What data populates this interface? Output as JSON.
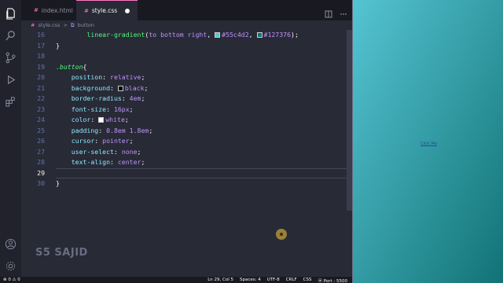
{
  "tabs": [
    {
      "icon": "#",
      "label": "index.html",
      "active": false
    },
    {
      "icon": "#",
      "label": "style.css",
      "active": true,
      "modified": true
    }
  ],
  "breadcrumb": {
    "file": "style.css",
    "separator": ">",
    "symbol": "button"
  },
  "editor": {
    "current_line": 29,
    "lines": [
      {
        "n": 16,
        "tokens": [
          {
            "t": "        "
          },
          {
            "t": "linear-gradient",
            "c": "fn"
          },
          {
            "t": "(",
            "c": "pl"
          },
          {
            "t": "to bottom right",
            "c": "val"
          },
          {
            "t": ", ",
            "c": "pl"
          },
          {
            "sw": "#55c4d2"
          },
          {
            "t": "#55c4d2",
            "c": "val"
          },
          {
            "t": ", ",
            "c": "pl"
          },
          {
            "sw": "#127376"
          },
          {
            "t": "#127376",
            "c": "val"
          },
          {
            "t": ");",
            "c": "pl"
          }
        ]
      },
      {
        "n": 17,
        "tokens": [
          {
            "t": "}",
            "c": "pl"
          }
        ]
      },
      {
        "n": 18,
        "tokens": []
      },
      {
        "n": 19,
        "tokens": [
          {
            "t": ".button",
            "c": "sel"
          },
          {
            "t": "{",
            "c": "pl"
          }
        ]
      },
      {
        "n": 20,
        "tokens": [
          {
            "t": "    "
          },
          {
            "t": "position",
            "c": "kw"
          },
          {
            "t": ": ",
            "c": "pl"
          },
          {
            "t": "relative",
            "c": "val"
          },
          {
            "t": ";",
            "c": "pl"
          }
        ]
      },
      {
        "n": 21,
        "tokens": [
          {
            "t": "    "
          },
          {
            "t": "background",
            "c": "kw"
          },
          {
            "t": ": ",
            "c": "pl"
          },
          {
            "sw": "#000000"
          },
          {
            "t": "black",
            "c": "val"
          },
          {
            "t": ";",
            "c": "pl"
          }
        ]
      },
      {
        "n": 22,
        "tokens": [
          {
            "t": "    "
          },
          {
            "t": "border-radius",
            "c": "kw"
          },
          {
            "t": ": ",
            "c": "pl"
          },
          {
            "t": "4em",
            "c": "val"
          },
          {
            "t": ";",
            "c": "pl"
          }
        ]
      },
      {
        "n": 23,
        "tokens": [
          {
            "t": "    "
          },
          {
            "t": "font-size",
            "c": "kw"
          },
          {
            "t": ": ",
            "c": "pl"
          },
          {
            "t": "16px",
            "c": "val"
          },
          {
            "t": ";",
            "c": "pl"
          }
        ]
      },
      {
        "n": 24,
        "tokens": [
          {
            "t": "    "
          },
          {
            "t": "color",
            "c": "kw"
          },
          {
            "t": ": ",
            "c": "pl"
          },
          {
            "sw": "#ffffff"
          },
          {
            "t": "white",
            "c": "val"
          },
          {
            "t": ";",
            "c": "pl"
          }
        ]
      },
      {
        "n": 25,
        "tokens": [
          {
            "t": "    "
          },
          {
            "t": "padding",
            "c": "kw"
          },
          {
            "t": ": ",
            "c": "pl"
          },
          {
            "t": "0.8em 1.8em",
            "c": "val"
          },
          {
            "t": ";",
            "c": "pl"
          }
        ]
      },
      {
        "n": 26,
        "tokens": [
          {
            "t": "    "
          },
          {
            "t": "cursor",
            "c": "kw"
          },
          {
            "t": ": ",
            "c": "pl"
          },
          {
            "t": "pointer",
            "c": "val"
          },
          {
            "t": ";",
            "c": "pl"
          }
        ]
      },
      {
        "n": 27,
        "tokens": [
          {
            "t": "    "
          },
          {
            "t": "user-select",
            "c": "kw"
          },
          {
            "t": ": ",
            "c": "pl"
          },
          {
            "t": "none",
            "c": "val"
          },
          {
            "t": ";",
            "c": "pl"
          }
        ]
      },
      {
        "n": 28,
        "tokens": [
          {
            "t": "    "
          },
          {
            "t": "text-align",
            "c": "kw"
          },
          {
            "t": ": ",
            "c": "pl"
          },
          {
            "t": "center",
            "c": "val"
          },
          {
            "t": ";",
            "c": "pl"
          }
        ]
      },
      {
        "n": 29,
        "tokens": []
      },
      {
        "n": 30,
        "tokens": [
          {
            "t": "}",
            "c": "pl"
          }
        ]
      }
    ]
  },
  "watermark": "S5 SAJID",
  "status": {
    "left": "⊗ 0 ⚠ 0",
    "items": [
      "Ln 29, Col 5",
      "Spaces: 4",
      "UTF-8",
      "CRLF",
      "CSS",
      "⦿ Port : 5500"
    ]
  },
  "preview": {
    "button_label": "Click Me"
  },
  "activity_icons": [
    "files-icon",
    "search-icon",
    "source-control-icon",
    "run-debug-icon",
    "extensions-icon",
    "account-icon",
    "settings-gear-icon"
  ],
  "colors": {
    "gradient_start": "#55c4d2",
    "gradient_end": "#127376",
    "accent": "#ff79c6"
  }
}
